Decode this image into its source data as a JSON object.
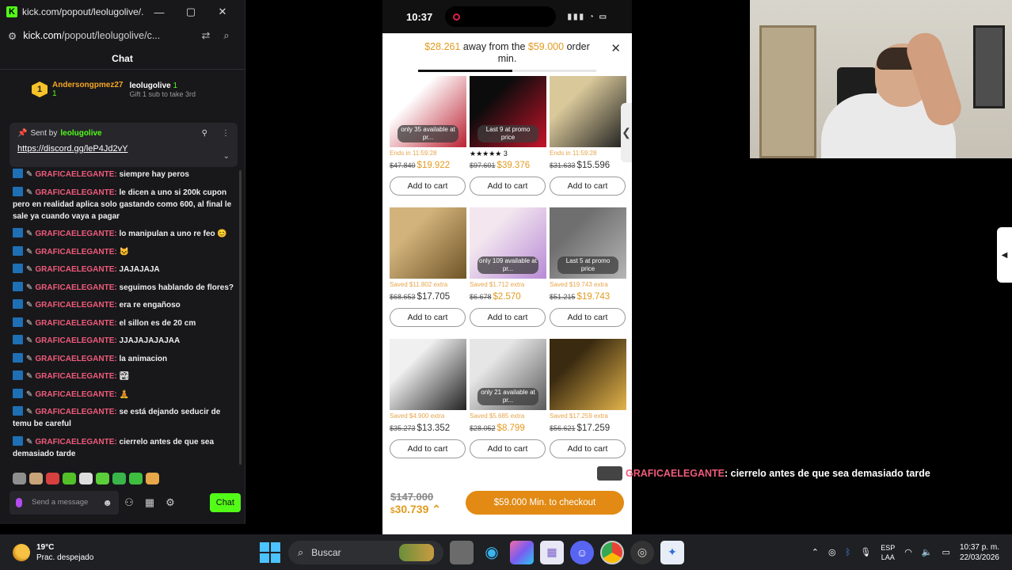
{
  "chat_window": {
    "title": "kick.com/popout/leolugolive/...",
    "url_host": "kick.com",
    "url_path": "/popout/leolugolive/c...",
    "header": "Chat",
    "gift": {
      "gifter": "Andersongpmez27",
      "gifter_count": "1",
      "recipient": "leolugolive",
      "recipient_count": "1",
      "subtext": "Gift 1 sub to take 3rd",
      "rank": "1"
    },
    "pinned": {
      "sent_by_label": "Sent by",
      "sender": "leolugolive",
      "link": "https://discord.gg/leP4Jd2vY"
    },
    "messages": [
      {
        "user": "GRAFICAELEGANTE:",
        "text": "siempre hay peros"
      },
      {
        "user": "GRAFICAELEGANTE:",
        "text": "le dicen a uno si 200k cupon pero en realidad aplica solo gastando como 600, al final le sale ya cuando vaya a pagar"
      },
      {
        "user": "GRAFICAELEGANTE:",
        "text": "lo manipulan a uno re feo 😊"
      },
      {
        "user": "GRAFICAELEGANTE:",
        "text": "🐱"
      },
      {
        "user": "GRAFICAELEGANTE:",
        "text": "JAJAJAJA"
      },
      {
        "user": "GRAFICAELEGANTE:",
        "text": "seguimos hablando de flores?"
      },
      {
        "user": "GRAFICAELEGANTE:",
        "text": "era re engañoso"
      },
      {
        "user": "GRAFICAELEGANTE:",
        "text": "el sillon es de 20 cm"
      },
      {
        "user": "GRAFICAELEGANTE:",
        "text": "JJAJAJAJAJAA"
      },
      {
        "user": "GRAFICAELEGANTE:",
        "text": "la animacion"
      },
      {
        "user": "GRAFICAELEGANTE:",
        "text": "🏞"
      },
      {
        "user": "GRAFICAELEGANTE:",
        "text": "🧘"
      },
      {
        "user": "GRAFICAELEGANTE:",
        "text": "se está dejando seducir de temu be careful"
      },
      {
        "user": "GRAFICAELEGANTE:",
        "text": "cierrelo antes de que sea demasiado tarde"
      }
    ],
    "input_placeholder": "Send a message",
    "chat_button": "Chat"
  },
  "phone": {
    "time": "10:37",
    "banner": {
      "amount_left": "$28.261",
      "middle": "away from the",
      "threshold": "$59.000",
      "end": "order min."
    },
    "progress": 0.53,
    "products": [
      {
        "overlay": "only 35 available at pr...",
        "meta": "Ends in 11:59:28",
        "old": "$47.840",
        "now": "$19.922",
        "orange": true,
        "img": [
          "#ffffff",
          "#bb2233"
        ]
      },
      {
        "overlay": "Last 9 at promo price",
        "meta": "★★★★★ 3",
        "stars": true,
        "old": "$97.601",
        "now": "$39.376",
        "orange": true,
        "img": [
          "#0c0c0c",
          "#c4142a"
        ]
      },
      {
        "overlay": "",
        "meta": "Ends in 11:59:28",
        "old": "$31.633",
        "now": "$15.596",
        "orange": false,
        "img": [
          "#d9c89a",
          "#1d1d1d"
        ]
      },
      {
        "overlay": "",
        "meta": "Saved $11.802 extra",
        "old": "$68.653",
        "now": "$17.705",
        "orange": false,
        "img": [
          "#d2b37b",
          "#6f5427"
        ]
      },
      {
        "overlay": "only 109 available at pr...",
        "meta": "Saved $1.712 extra",
        "old": "$6.678",
        "now": "$2.570",
        "orange": true,
        "img": [
          "#f3e6ef",
          "#b88ad6"
        ]
      },
      {
        "overlay": "Last 5 at promo price",
        "meta": "Saved $19.743 extra",
        "old": "$51.215",
        "now": "$19.743",
        "orange": true,
        "img": [
          "#6f6f6f",
          "#b5b5b5"
        ]
      },
      {
        "overlay": "",
        "meta": "Saved $4.900 extra",
        "old": "$35.273",
        "now": "$13.352",
        "orange": false,
        "img": [
          "#f0f0f0",
          "#222222"
        ]
      },
      {
        "overlay": "only 21 available at pr...",
        "meta": "Saved $5.685 extra",
        "old": "$28.052",
        "now": "$8.799",
        "orange": true,
        "img": [
          "#e6e6e6",
          "#5a5a5a"
        ]
      },
      {
        "overlay": "",
        "meta": "Saved $17.259 extra",
        "old": "$56.621",
        "now": "$17.259",
        "orange": false,
        "img": [
          "#3a2a10",
          "#e2b34a"
        ]
      }
    ],
    "add_to_cart": "Add to cart",
    "bottom": {
      "old_total": "$147.000",
      "new_total": "30.739",
      "new_prefix": "$",
      "checkout": "$59.000 Min. to checkout"
    }
  },
  "overlay_message": {
    "user": "GRAFICAELEGANTE",
    "text": ": cierrelo antes de que sea demasiado tarde"
  },
  "taskbar": {
    "temperature": "19°C",
    "condition": "Prac. despejado",
    "search_placeholder": "Buscar",
    "lang": "ESP",
    "lang2": "LAA",
    "time": "10:37 p. m.",
    "date": "22/03/2026"
  },
  "colors": {
    "kick_green": "#53fc18",
    "username_pink": "#ef5b7a",
    "price_orange": "#e29a1f",
    "checkout_orange": "#e28a13"
  }
}
